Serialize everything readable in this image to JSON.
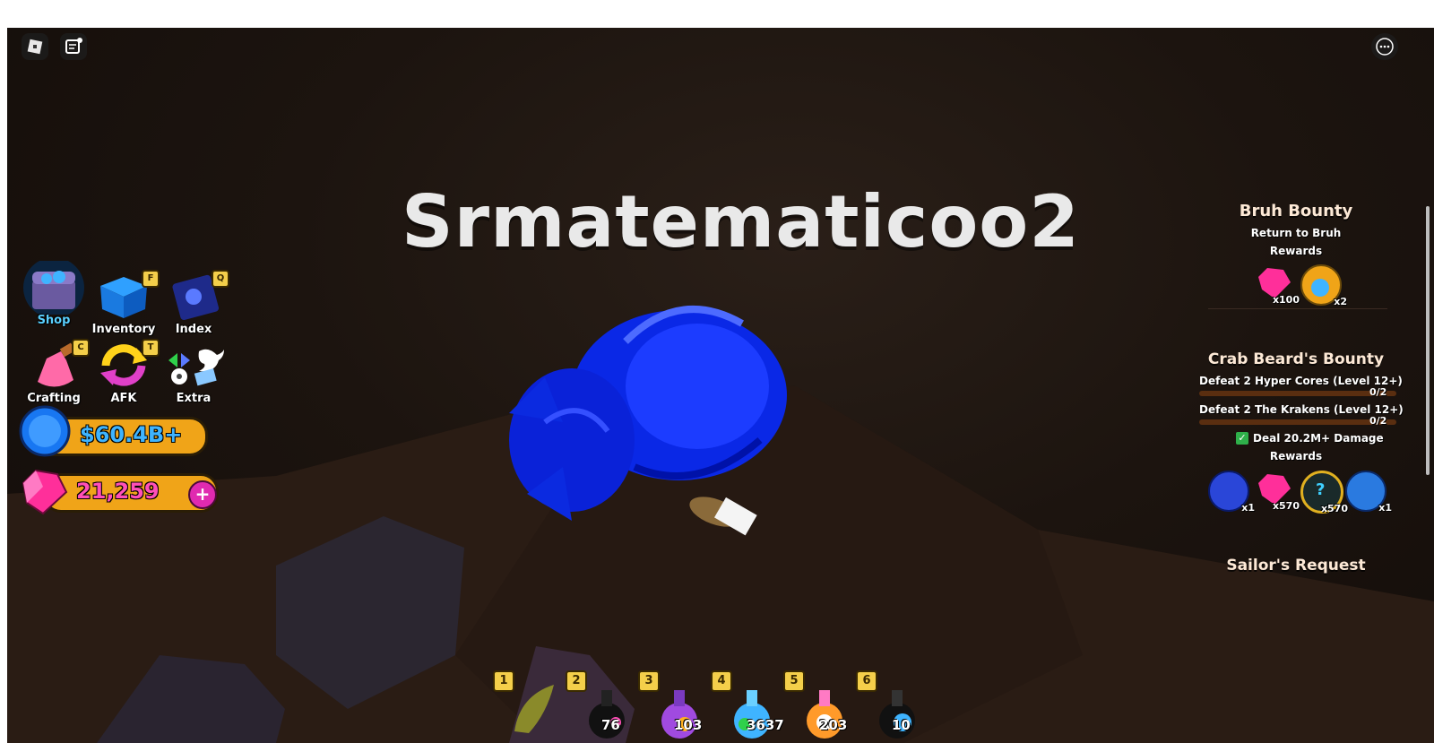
{
  "player": {
    "name": "Srmatematicoo2"
  },
  "menu": {
    "shop": {
      "label": "Shop"
    },
    "inventory": {
      "label": "Inventory",
      "hotkey": "F"
    },
    "index": {
      "label": "Index",
      "hotkey": "Q"
    },
    "crafting": {
      "label": "Crafting",
      "hotkey": "C"
    },
    "afk": {
      "label": "AFK",
      "hotkey": "T"
    },
    "extra": {
      "label": "Extra"
    }
  },
  "currency": {
    "coins": "$60.4B+",
    "gems": "21,259",
    "coins_color": "#3fb4ff",
    "gems_color": "#ff4fb8"
  },
  "quests": {
    "bruh": {
      "title": "Bruh Bounty",
      "task": "Return to Bruh",
      "rewards_label": "Rewards",
      "rewards": [
        {
          "icon": "pink-gem-icon",
          "count": "x100"
        },
        {
          "icon": "blue-potion-orb-icon",
          "count": "x2"
        }
      ]
    },
    "crab": {
      "title": "Crab Beard's Bounty",
      "tasks": [
        {
          "text": "Defeat 2 Hyper Cores (Level 12+)",
          "progress": "0/2",
          "fraction": 0
        },
        {
          "text": "Defeat 2 The Krakens (Level 12+)",
          "progress": "0/2",
          "fraction": 0
        }
      ],
      "done_task": "Deal 20.2M+ Damage",
      "check": "✓",
      "rewards_label": "Rewards",
      "rewards": [
        {
          "icon": "blue-core-icon",
          "count": "x1"
        },
        {
          "icon": "pink-gem-icon",
          "count": "x570"
        },
        {
          "icon": "mystery-orb-icon",
          "count": "x570"
        },
        {
          "icon": "blue-egg-icon",
          "count": "x1"
        }
      ]
    },
    "sailor": {
      "title": "Sailor's Request"
    }
  },
  "hotbar": [
    {
      "num": "1",
      "qty": ""
    },
    {
      "num": "2",
      "qty": "76"
    },
    {
      "num": "3",
      "qty": "103"
    },
    {
      "num": "4",
      "qty": "3637"
    },
    {
      "num": "5",
      "qty": "203"
    },
    {
      "num": "6",
      "qty": "10"
    }
  ]
}
